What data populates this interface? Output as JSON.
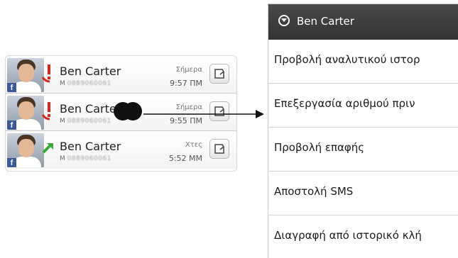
{
  "call_log": {
    "entries": [
      {
        "name": "Ben Carter",
        "number_type": "M",
        "number": "0889060061",
        "day": "Σήμερα",
        "time": "9:57 ΠΜ",
        "call_type": "missed",
        "source_badge": "f"
      },
      {
        "name": "Ben Carte",
        "number_type": "M",
        "number": "0889060061",
        "day": "Σήμερα",
        "time": "9:55 ΠΜ",
        "call_type": "missed",
        "source_badge": "f"
      },
      {
        "name": "Ben Carter",
        "number_type": "M",
        "number": "0889060061",
        "day": "Χτες",
        "time": "5:52 ΜΜ",
        "call_type": "outgoing",
        "source_badge": "f"
      }
    ]
  },
  "context_menu": {
    "title": "Ben Carter",
    "items": [
      "Προβολή αναλυτικού ιστορ",
      "Επεξεργασία αριθμού πριν",
      "Προβολή επαφής",
      "Αποστολή SMS",
      "Διαγραφή από ιστορικό κλή"
    ]
  },
  "colors": {
    "missed_call": "#d7281e",
    "outgoing_call": "#3aa83a",
    "facebook_badge": "#3b5998",
    "menu_header": "#3d3d3d"
  },
  "icons": {
    "missed": "missed-call-icon",
    "outgoing": "outgoing-call-icon",
    "message": "sms-button-icon",
    "menu": "menu-collapse-icon"
  }
}
